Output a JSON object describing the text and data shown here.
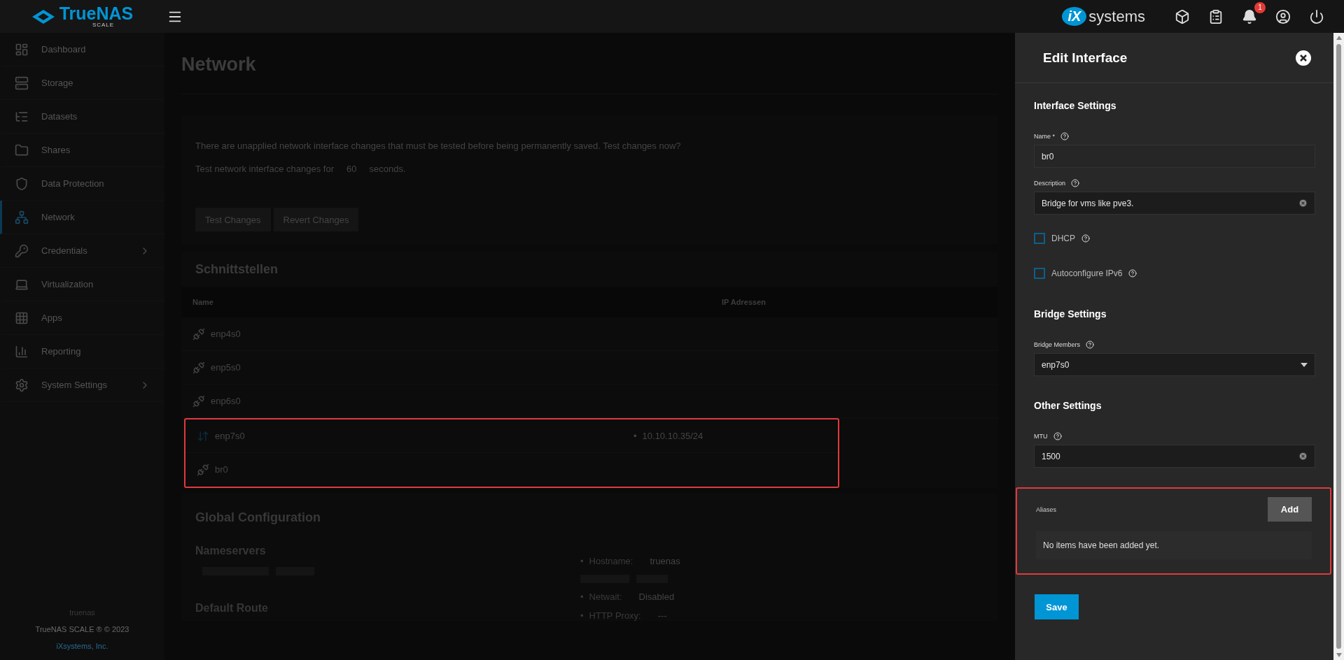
{
  "topbar": {
    "logo": {
      "name": "TrueNAS",
      "edition": "SCALE"
    },
    "vendor": {
      "mark": "iX",
      "word": "systems"
    },
    "notification_count": "1"
  },
  "sidebar": {
    "items": [
      {
        "label": "Dashboard",
        "selected": false,
        "expandable": false
      },
      {
        "label": "Storage",
        "selected": false,
        "expandable": false
      },
      {
        "label": "Datasets",
        "selected": false,
        "expandable": false
      },
      {
        "label": "Shares",
        "selected": false,
        "expandable": false
      },
      {
        "label": "Data Protection",
        "selected": false,
        "expandable": false
      },
      {
        "label": "Network",
        "selected": true,
        "expandable": false
      },
      {
        "label": "Credentials",
        "selected": false,
        "expandable": true
      },
      {
        "label": "Virtualization",
        "selected": false,
        "expandable": false
      },
      {
        "label": "Apps",
        "selected": false,
        "expandable": false
      },
      {
        "label": "Reporting",
        "selected": false,
        "expandable": false
      },
      {
        "label": "System Settings",
        "selected": false,
        "expandable": true
      }
    ],
    "hostname": "truenas",
    "copyright": "TrueNAS SCALE ® © 2023",
    "company": "iXsystems, Inc."
  },
  "page": {
    "title": "Network",
    "pending": {
      "message": "There are unapplied network interface changes that must be tested before being permanently saved. Test changes now?",
      "timeout_prefix": "Test network interface changes for",
      "timeout_value": "60",
      "timeout_suffix": "seconds.",
      "buttons": [
        "Test Changes",
        "Revert Changes"
      ]
    },
    "interfaces": {
      "title": "Schnittstellen",
      "columns": [
        "Name",
        "IP Adressen"
      ],
      "rows": [
        {
          "name": "enp4s0",
          "link_up": false,
          "addresses": [],
          "highlighted": false
        },
        {
          "name": "enp5s0",
          "link_up": false,
          "addresses": [],
          "highlighted": false
        },
        {
          "name": "enp6s0",
          "link_up": false,
          "addresses": [],
          "highlighted": false
        },
        {
          "name": "enp7s0",
          "link_up": true,
          "addresses": [
            {
              "marker": "•",
              "text": "10.10.10.35/24"
            }
          ],
          "highlighted": true
        },
        {
          "name": "br0",
          "link_up": false,
          "addresses": [],
          "highlighted": true
        }
      ]
    },
    "global": {
      "title": "Global Configuration",
      "nameservers_title": "Nameservers",
      "default_route_title": "Default Route",
      "settings": [
        {
          "kind": "pair",
          "marker": "•",
          "label": "Hostname:",
          "value": "truenas"
        },
        {
          "kind": "redacted"
        },
        {
          "kind": "pair",
          "marker": "•",
          "label": "Netwait:",
          "value": "Disabled"
        },
        {
          "kind": "pair",
          "marker": "•",
          "label": "HTTP Proxy:",
          "value": "---"
        }
      ]
    }
  },
  "panel": {
    "title": "Edit Interface",
    "sections": [
      {
        "title": "Interface Settings",
        "fields": [
          {
            "kind": "input",
            "label": "Name *",
            "value": "br0",
            "clearable": false
          },
          {
            "kind": "input",
            "label": "Description",
            "value": "Bridge for vms like pve3.",
            "clearable": true
          },
          {
            "kind": "checkbox",
            "label": "DHCP",
            "checked": false
          },
          {
            "kind": "checkbox",
            "label": "Autoconfigure IPv6",
            "checked": false
          }
        ]
      },
      {
        "title": "Bridge Settings",
        "fields": [
          {
            "kind": "select",
            "label": "Bridge Members",
            "value": "enp7s0"
          }
        ]
      },
      {
        "title": "Other Settings",
        "fields": [
          {
            "kind": "input",
            "label": "MTU",
            "value": "1500",
            "clearable": true
          }
        ]
      }
    ],
    "aliases": {
      "label": "Aliases",
      "add": "Add",
      "empty": "No items have been added yet.",
      "highlighted": true
    },
    "save": "Save"
  }
}
